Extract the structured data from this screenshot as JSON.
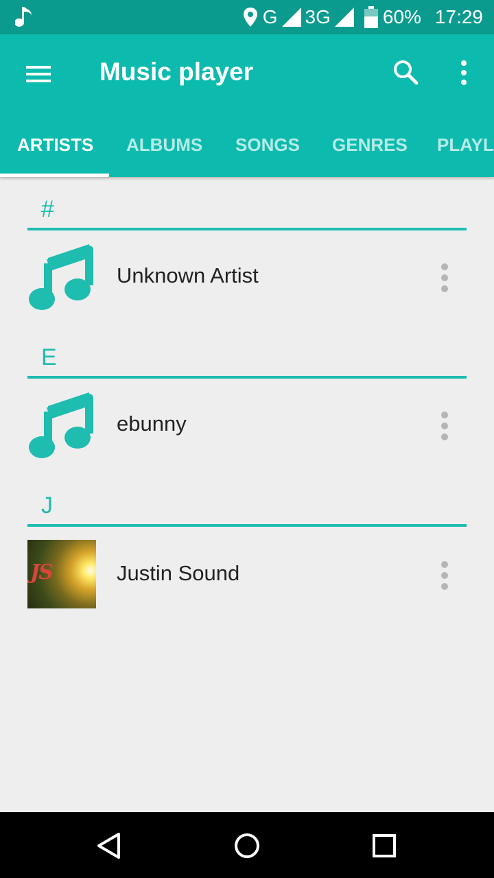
{
  "status_bar": {
    "network_g": "G",
    "network_3g": "3G",
    "battery": "60%",
    "time": "17:29"
  },
  "app_bar": {
    "title": "Music player"
  },
  "tabs": [
    {
      "label": "ARTISTS",
      "active": true
    },
    {
      "label": "ALBUMS",
      "active": false
    },
    {
      "label": "SONGS",
      "active": false
    },
    {
      "label": "GENRES",
      "active": false
    },
    {
      "label": "PLAYLISTS",
      "active": false
    }
  ],
  "sections": [
    {
      "letter": "#",
      "artists": [
        {
          "name": "Unknown Artist",
          "art": "music-note-icon"
        }
      ]
    },
    {
      "letter": "E",
      "artists": [
        {
          "name": "ebunny",
          "art": "music-note-icon"
        }
      ]
    },
    {
      "letter": "J",
      "artists": [
        {
          "name": "Justin Sound",
          "art": "album-art-image",
          "art_text": "JS"
        }
      ]
    }
  ],
  "colors": {
    "status_bar": "#0a9b8e",
    "app_bar": "#0cbbae",
    "accent": "#1fbcb0",
    "background": "#eeeeee"
  }
}
